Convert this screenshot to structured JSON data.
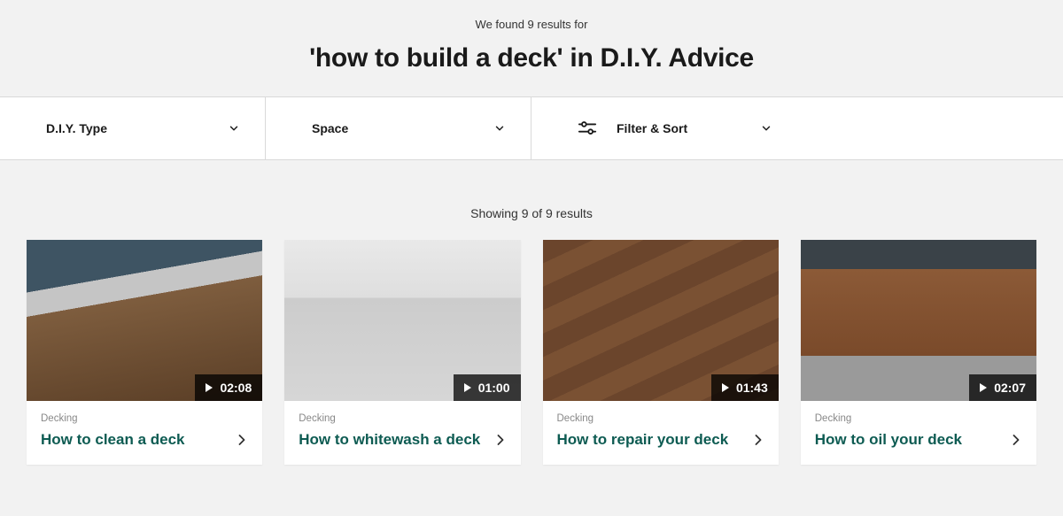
{
  "header": {
    "results_for": "We found 9 results for",
    "title": "'how to build a deck' in D.I.Y. Advice"
  },
  "filters": {
    "type_label": "D.I.Y. Type",
    "space_label": "Space",
    "filter_sort_label": "Filter & Sort"
  },
  "showing_text": "Showing 9 of 9 results",
  "cards": [
    {
      "category": "Decking",
      "title": "How to clean a deck",
      "duration": "02:08"
    },
    {
      "category": "Decking",
      "title": "How to whitewash a deck",
      "duration": "01:00"
    },
    {
      "category": "Decking",
      "title": "How to repair your deck",
      "duration": "01:43"
    },
    {
      "category": "Decking",
      "title": "How to oil your deck",
      "duration": "02:07"
    }
  ]
}
